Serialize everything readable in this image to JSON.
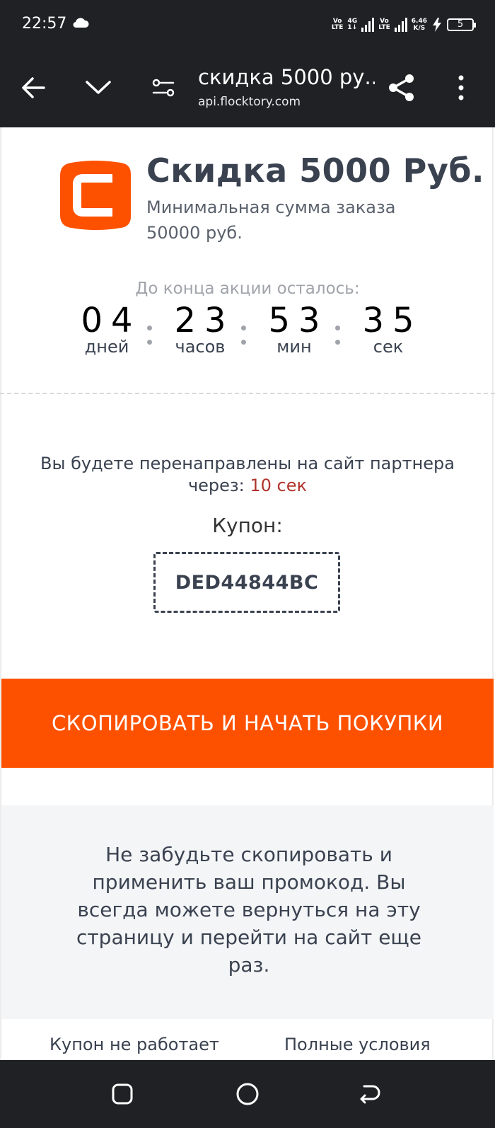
{
  "status_bar": {
    "time": "22:57",
    "net1_top": "Vo",
    "net1_bottom": "LTE",
    "net2_top": "4G",
    "net2_bottom": "1↓",
    "net3_top": "Vo",
    "net3_bottom": "LTE",
    "speed_value": "6.46",
    "speed_unit": "K/S",
    "battery": "5"
  },
  "browser": {
    "page_title": "скидка 5000 ру...",
    "url": "api.flocktory.com"
  },
  "offer": {
    "title": "Скидка 5000 Руб.",
    "subtitle": "Минимальная сумма заказа 50000 руб.",
    "brand_color": "#fe5100"
  },
  "countdown": {
    "label": "До конца акции осталось:",
    "days": "04",
    "days_label": "дней",
    "hours": "23",
    "hours_label": "часов",
    "minutes": "53",
    "minutes_label": "мин",
    "seconds": "35",
    "seconds_label": "сек"
  },
  "redirect": {
    "text": "Вы будете перенаправлены на сайт партнера через: ",
    "timer": "10 сек"
  },
  "coupon": {
    "label": "Купон:",
    "code": "DED44844BC"
  },
  "cta": {
    "label": "СКОПИРОВАТЬ И НАЧАТЬ ПОКУПКИ"
  },
  "reminder": {
    "text": "Не забудьте скопировать и применить ваш промокод. Вы всегда можете вернуться на эту страницу и перейти на сайт еще раз."
  },
  "footer": {
    "link_left": "Купон не работает",
    "link_right": "Полные условия"
  },
  "icons": {
    "back": "arrow-left-icon",
    "collapse": "chevron-down-icon",
    "page_settings": "tune-icon",
    "share": "share-icon",
    "menu": "more-vertical-icon",
    "nav_recents": "square-icon",
    "nav_home": "circle-icon",
    "nav_back": "return-icon"
  }
}
